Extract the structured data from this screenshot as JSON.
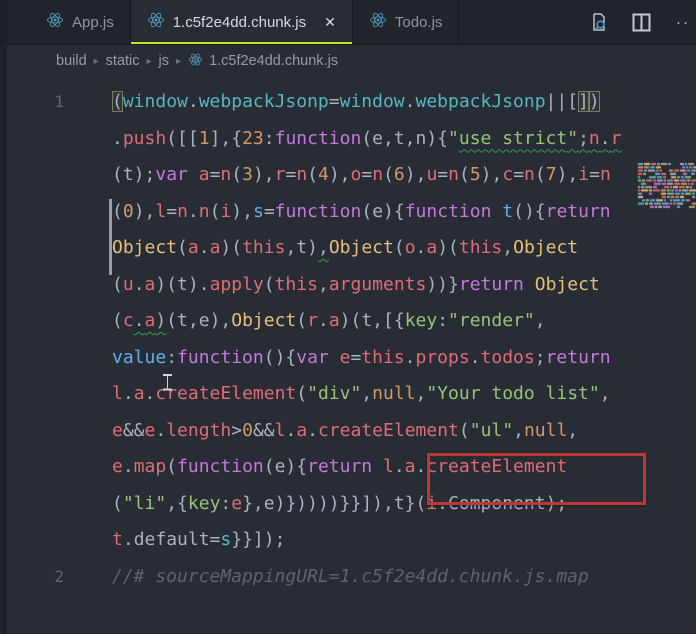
{
  "tabs": [
    {
      "label": "App.js",
      "active": false
    },
    {
      "label": "1.c5f2e4dd.chunk.js",
      "active": true,
      "close_label": "✕"
    },
    {
      "label": "Todo.js",
      "active": false
    }
  ],
  "actions": {
    "more_label": "···"
  },
  "breadcrumb": [
    "build",
    "static",
    "js",
    "1.c5f2e4dd.chunk.js"
  ],
  "annotation": {
    "target_text": "\"Your todo list\",",
    "color": "#bd3734"
  },
  "colors": {
    "accent_underline": "#c9e513",
    "icon_blue": "#519aba",
    "squiggle_green": "#3a9e4e",
    "minimap_palette": [
      "#e06c75",
      "#98c379",
      "#d19a66",
      "#c678dd",
      "#56b6c2",
      "#e5c07b",
      "#abb2bf",
      "#61afef"
    ]
  },
  "editor": {
    "rows": [
      {
        "ln": "1",
        "t": [
          [
            "(",
            "d",
            "x"
          ],
          [
            "window",
            "c"
          ],
          [
            ".",
            "d"
          ],
          [
            "webpackJsonp",
            "c"
          ],
          [
            "=",
            "d"
          ],
          [
            "window",
            "c"
          ],
          [
            ".",
            "d"
          ],
          [
            "webpackJsonp",
            "c"
          ],
          [
            "||[",
            "d"
          ],
          [
            "]",
            "d",
            "x"
          ],
          [
            ")",
            "d",
            "x"
          ]
        ]
      },
      {
        "ln": "",
        "t": [
          [
            ".",
            "d"
          ],
          [
            "push",
            "r"
          ],
          [
            "([[",
            "d"
          ],
          [
            "1",
            "o"
          ],
          [
            "],{",
            "d"
          ],
          [
            "23",
            "o"
          ],
          [
            ":",
            "d"
          ],
          [
            "function",
            "m"
          ],
          [
            "(e,t,n){",
            "d"
          ],
          [
            "\"",
            "g"
          ],
          [
            "use strict",
            "g",
            "u"
          ],
          [
            "\"",
            "g",
            "u"
          ],
          [
            ";",
            "d",
            "u"
          ],
          [
            "n",
            "r",
            "u"
          ],
          [
            ".",
            "d",
            "u"
          ],
          [
            "r",
            "r",
            "u"
          ]
        ]
      },
      {
        "ln": "",
        "t": [
          [
            "(t);",
            "d"
          ],
          [
            "var",
            "m"
          ],
          [
            " ",
            "d"
          ],
          [
            "a",
            "r"
          ],
          [
            "=",
            "d"
          ],
          [
            "n",
            "r"
          ],
          [
            "(",
            "d"
          ],
          [
            "3",
            "o"
          ],
          [
            "),",
            "d"
          ],
          [
            "r",
            "r"
          ],
          [
            "=",
            "d"
          ],
          [
            "n",
            "r"
          ],
          [
            "(",
            "d"
          ],
          [
            "4",
            "o"
          ],
          [
            "),",
            "d"
          ],
          [
            "o",
            "r"
          ],
          [
            "=",
            "d"
          ],
          [
            "n",
            "r"
          ],
          [
            "(",
            "d"
          ],
          [
            "6",
            "o"
          ],
          [
            "),",
            "d"
          ],
          [
            "u",
            "r"
          ],
          [
            "=",
            "d"
          ],
          [
            "n",
            "r"
          ],
          [
            "(",
            "d"
          ],
          [
            "5",
            "o"
          ],
          [
            "),",
            "d"
          ],
          [
            "c",
            "r"
          ],
          [
            "=",
            "d"
          ],
          [
            "n",
            "r"
          ],
          [
            "(",
            "d"
          ],
          [
            "7",
            "o"
          ],
          [
            "),",
            "d"
          ],
          [
            "i",
            "r"
          ],
          [
            "=",
            "d"
          ],
          [
            "n",
            "r"
          ]
        ]
      },
      {
        "ln": "",
        "t": [
          [
            "(",
            "d"
          ],
          [
            "0",
            "o"
          ],
          [
            "),",
            "d"
          ],
          [
            "l",
            "r"
          ],
          [
            "=",
            "d"
          ],
          [
            "n",
            "r"
          ],
          [
            ".",
            "d"
          ],
          [
            "n",
            "r"
          ],
          [
            "(",
            "d"
          ],
          [
            "i",
            "r"
          ],
          [
            "),",
            "d"
          ],
          [
            "s",
            "b"
          ],
          [
            "=",
            "d"
          ],
          [
            "function",
            "m"
          ],
          [
            "(e){",
            "d"
          ],
          [
            "function",
            "m"
          ],
          [
            " ",
            "d"
          ],
          [
            "t",
            "b"
          ],
          [
            "(){",
            "d"
          ],
          [
            "return",
            "m"
          ]
        ]
      },
      {
        "ln": "",
        "t": [
          [
            "Object",
            "y"
          ],
          [
            "(",
            "d"
          ],
          [
            "a",
            "r"
          ],
          [
            ".",
            "d"
          ],
          [
            "a",
            "r"
          ],
          [
            ")(",
            "d"
          ],
          [
            "this",
            "r"
          ],
          [
            ",t)",
            "d"
          ],
          [
            ",",
            "d",
            "u"
          ],
          [
            "Object",
            "y"
          ],
          [
            "(",
            "d"
          ],
          [
            "o",
            "r"
          ],
          [
            ".",
            "d"
          ],
          [
            "a",
            "r"
          ],
          [
            ")(",
            "d"
          ],
          [
            "this",
            "r"
          ],
          [
            ",",
            "d"
          ],
          [
            "Object",
            "y"
          ]
        ]
      },
      {
        "ln": "",
        "t": [
          [
            "(",
            "d"
          ],
          [
            "u",
            "r"
          ],
          [
            ".",
            "d"
          ],
          [
            "a",
            "r"
          ],
          [
            ")(t).",
            "d"
          ],
          [
            "apply",
            "r"
          ],
          [
            "(",
            "d"
          ],
          [
            "this",
            "r"
          ],
          [
            ",",
            "d"
          ],
          [
            "arguments",
            "r"
          ],
          [
            "))}",
            "d"
          ],
          [
            "return",
            "m"
          ],
          [
            " ",
            "d"
          ],
          [
            "Object",
            "y"
          ]
        ]
      },
      {
        "ln": "",
        "t": [
          [
            "(",
            "d"
          ],
          [
            "c",
            "r"
          ],
          [
            ".",
            "d",
            "u"
          ],
          [
            "a",
            "r",
            "u"
          ],
          [
            ")",
            "d",
            "u"
          ],
          [
            "(t,e),",
            "d"
          ],
          [
            "Object",
            "y"
          ],
          [
            "(",
            "d"
          ],
          [
            "r",
            "r"
          ],
          [
            ".",
            "d"
          ],
          [
            "a",
            "r"
          ],
          [
            ")(t,[{",
            "d"
          ],
          [
            "key",
            "g"
          ],
          [
            ":",
            "d"
          ],
          [
            "\"render\"",
            "g"
          ],
          [
            ",",
            "d"
          ]
        ]
      },
      {
        "ln": "",
        "t": [
          [
            "value",
            "b"
          ],
          [
            ":",
            "d"
          ],
          [
            "function",
            "m"
          ],
          [
            "(){",
            "d"
          ],
          [
            "var",
            "m"
          ],
          [
            " ",
            "d"
          ],
          [
            "e",
            "r"
          ],
          [
            "=",
            "d"
          ],
          [
            "this",
            "r"
          ],
          [
            ".",
            "d"
          ],
          [
            "props",
            "r"
          ],
          [
            ".",
            "d"
          ],
          [
            "todos",
            "r"
          ],
          [
            ";",
            "d"
          ],
          [
            "return",
            "m"
          ]
        ]
      },
      {
        "ln": "",
        "t": [
          [
            "l",
            "r"
          ],
          [
            ".",
            "d"
          ],
          [
            "a",
            "r"
          ],
          [
            ".",
            "d"
          ],
          [
            "createElement",
            "r"
          ],
          [
            "(",
            "d"
          ],
          [
            "\"div\"",
            "g"
          ],
          [
            ",",
            "d"
          ],
          [
            "null",
            "o"
          ],
          [
            ",",
            "d"
          ],
          [
            "\"Your todo list\"",
            "g"
          ],
          [
            ",",
            "d"
          ]
        ]
      },
      {
        "ln": "",
        "t": [
          [
            "e",
            "r"
          ],
          [
            "&&",
            "d"
          ],
          [
            "e",
            "r"
          ],
          [
            ".",
            "d"
          ],
          [
            "length",
            "r"
          ],
          [
            ">",
            "d"
          ],
          [
            "0",
            "o"
          ],
          [
            "&&",
            "d"
          ],
          [
            "l",
            "r"
          ],
          [
            ".",
            "d"
          ],
          [
            "a",
            "r"
          ],
          [
            ".",
            "d"
          ],
          [
            "createElement",
            "r"
          ],
          [
            "(",
            "d"
          ],
          [
            "\"ul\"",
            "g"
          ],
          [
            ",",
            "d"
          ],
          [
            "null",
            "o"
          ],
          [
            ",",
            "d"
          ]
        ]
      },
      {
        "ln": "",
        "t": [
          [
            "e",
            "r"
          ],
          [
            ".",
            "d"
          ],
          [
            "map",
            "r"
          ],
          [
            "(",
            "d"
          ],
          [
            "function",
            "m"
          ],
          [
            "(e){",
            "d"
          ],
          [
            "return",
            "m"
          ],
          [
            " ",
            "d"
          ],
          [
            "l",
            "r"
          ],
          [
            ".",
            "d"
          ],
          [
            "a",
            "r"
          ],
          [
            ".",
            "d"
          ],
          [
            "createElement",
            "r"
          ]
        ]
      },
      {
        "ln": "",
        "t": [
          [
            "(",
            "d"
          ],
          [
            "\"li\"",
            "g"
          ],
          [
            ",{",
            "d"
          ],
          [
            "key",
            "g"
          ],
          [
            ":",
            "d"
          ],
          [
            "e",
            "r"
          ],
          [
            "},e)}))))}}]),t}(",
            "d"
          ],
          [
            "i",
            "r"
          ],
          [
            ".",
            "d"
          ],
          [
            "Component",
            "d"
          ],
          [
            ");",
            "d"
          ]
        ]
      },
      {
        "ln": "",
        "t": [
          [
            "t",
            "r"
          ],
          [
            ".",
            "d"
          ],
          [
            "default",
            "d"
          ],
          [
            "=",
            "d"
          ],
          [
            "s",
            "c"
          ],
          [
            "}}]);",
            "d"
          ]
        ]
      },
      {
        "ln": "2",
        "t": [
          [
            "//# sourceMappingURL=1.c5f2e4dd.chunk.js.map",
            "k"
          ]
        ]
      }
    ]
  }
}
